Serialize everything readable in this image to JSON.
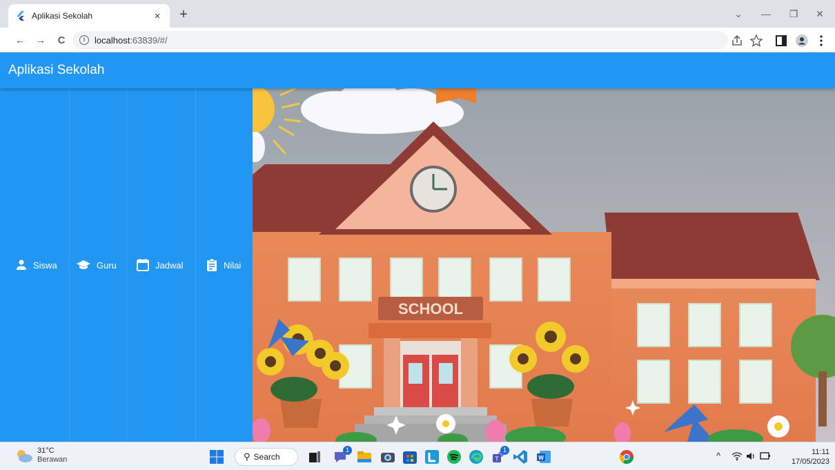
{
  "browser": {
    "tab_title": "Aplikasi Sekolah",
    "tab_close": "×",
    "new_tab": "+",
    "url_host": "localhost",
    "url_path": ":63839/#/",
    "window_controls": {
      "dropdown": "⌄",
      "minimize": "—",
      "restore": "❐",
      "close": "✕"
    },
    "nav": {
      "back": "←",
      "forward": "→",
      "reload": "C"
    }
  },
  "app": {
    "title": "Aplikasi Sekolah",
    "nav_items": [
      {
        "label": "Siswa",
        "icon": "person-icon"
      },
      {
        "label": "Guru",
        "icon": "school-cap-icon"
      },
      {
        "label": "Jadwal",
        "icon": "calendar-icon"
      },
      {
        "label": "Nilai",
        "icon": "clipboard-icon"
      }
    ],
    "hero_sign": "SCHOOL",
    "colors": {
      "primary": "#2196f3"
    }
  },
  "taskbar": {
    "temperature": "31°C",
    "weather_condition": "Berawan",
    "search_label": "Search",
    "badges": {
      "chat": "1",
      "teams": "1"
    },
    "time": "11:11",
    "date": "17/05/2023"
  }
}
